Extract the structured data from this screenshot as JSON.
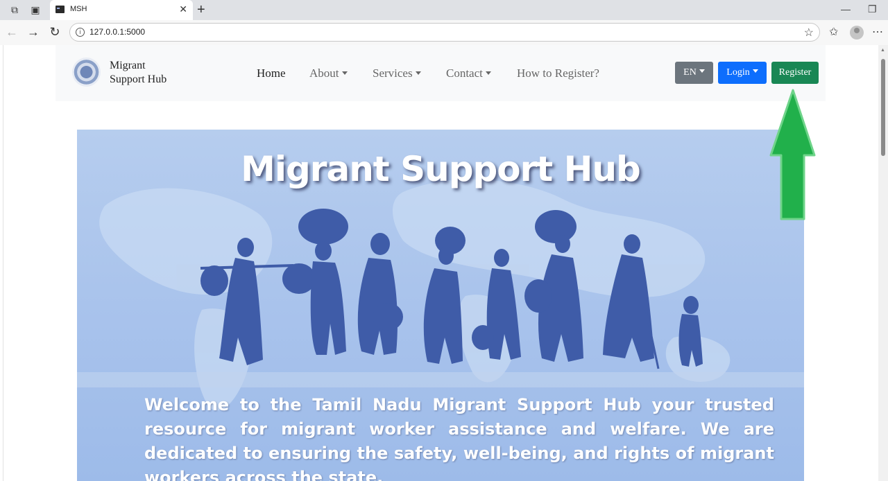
{
  "browser": {
    "tab_title": "MSH",
    "url": "127.0.0.1:5000",
    "new_tab_symbol": "+"
  },
  "navbar": {
    "brand_line1": "Migrant",
    "brand_line2": "Support Hub",
    "links": [
      {
        "label": "Home",
        "active": true,
        "dropdown": false
      },
      {
        "label": "About",
        "active": false,
        "dropdown": true
      },
      {
        "label": "Services",
        "active": false,
        "dropdown": true
      },
      {
        "label": "Contact",
        "active": false,
        "dropdown": true
      },
      {
        "label": "How to Register?",
        "active": false,
        "dropdown": false
      }
    ],
    "language_button": "EN",
    "login_button": "Login",
    "register_button": "Register"
  },
  "hero": {
    "title": "Migrant Support Hub",
    "text": "Welcome to the Tamil Nadu Migrant Support Hub your trusted resource for migrant worker assistance and welfare. We are dedicated to ensuring the safety, well-being, and rights of migrant workers across the state."
  },
  "colors": {
    "language_button": "#6c757d",
    "login_button": "#0d6efd",
    "register_button": "#198754",
    "annotation_arrow": "#21b04b"
  },
  "icons": [
    "workspaces-icon",
    "tab-actions-icon",
    "terminal-favicon-icon",
    "close-icon",
    "back-icon",
    "forward-icon",
    "reload-icon",
    "info-icon",
    "star-icon",
    "favorites-icon",
    "profile-avatar",
    "more-icon",
    "globe-logo-icon",
    "arrow-up-annotation"
  ]
}
